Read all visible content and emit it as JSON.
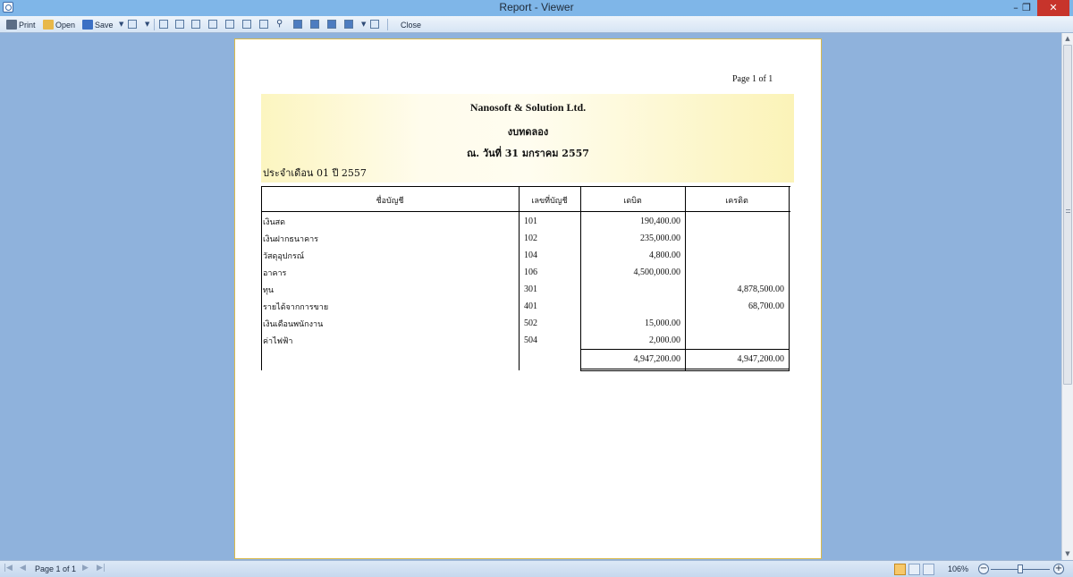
{
  "window": {
    "title": "Report - Viewer",
    "minimize_glyph": "–",
    "restore_glyph": "❐",
    "close_glyph": "✕"
  },
  "toolbar": {
    "print_label": "Print",
    "open_label": "Open",
    "save_label": "Save",
    "close_label": "Close"
  },
  "report": {
    "page_indicator": "Page 1 of 1",
    "company": "Nanosoft & Solution Ltd.",
    "heading": "งบทดลอง",
    "as_of": "ณ. วันที่  31 มกราคม 2557",
    "period": "ประจำเดือน 01 ปี 2557",
    "columns": {
      "account_name": "ชื่อบัญชี",
      "account_no": "เลขที่บัญชี",
      "debit": "เดบิต",
      "credit": "เครดิต"
    },
    "rows": [
      {
        "name": "เงินสด",
        "code": "101",
        "debit": "190,400.00",
        "credit": ""
      },
      {
        "name": "เงินฝากธนาคาร",
        "code": "102",
        "debit": "235,000.00",
        "credit": ""
      },
      {
        "name": "วัสดุอุปกรณ์",
        "code": "104",
        "debit": "4,800.00",
        "credit": ""
      },
      {
        "name": "อาคาร",
        "code": "106",
        "debit": "4,500,000.00",
        "credit": ""
      },
      {
        "name": "ทุน",
        "code": "301",
        "debit": "",
        "credit": "4,878,500.00"
      },
      {
        "name": "รายได้จากการขาย",
        "code": "401",
        "debit": "",
        "credit": "68,700.00"
      },
      {
        "name": "เงินเดือนพนักงาน",
        "code": "502",
        "debit": "15,000.00",
        "credit": ""
      },
      {
        "name": "ค่าไฟฟ้า",
        "code": "504",
        "debit": "2,000.00",
        "credit": ""
      }
    ],
    "totals": {
      "debit": "4,947,200.00",
      "credit": "4,947,200.00"
    }
  },
  "statusbar": {
    "page_info": "Page 1 of 1",
    "zoom": "106%"
  }
}
